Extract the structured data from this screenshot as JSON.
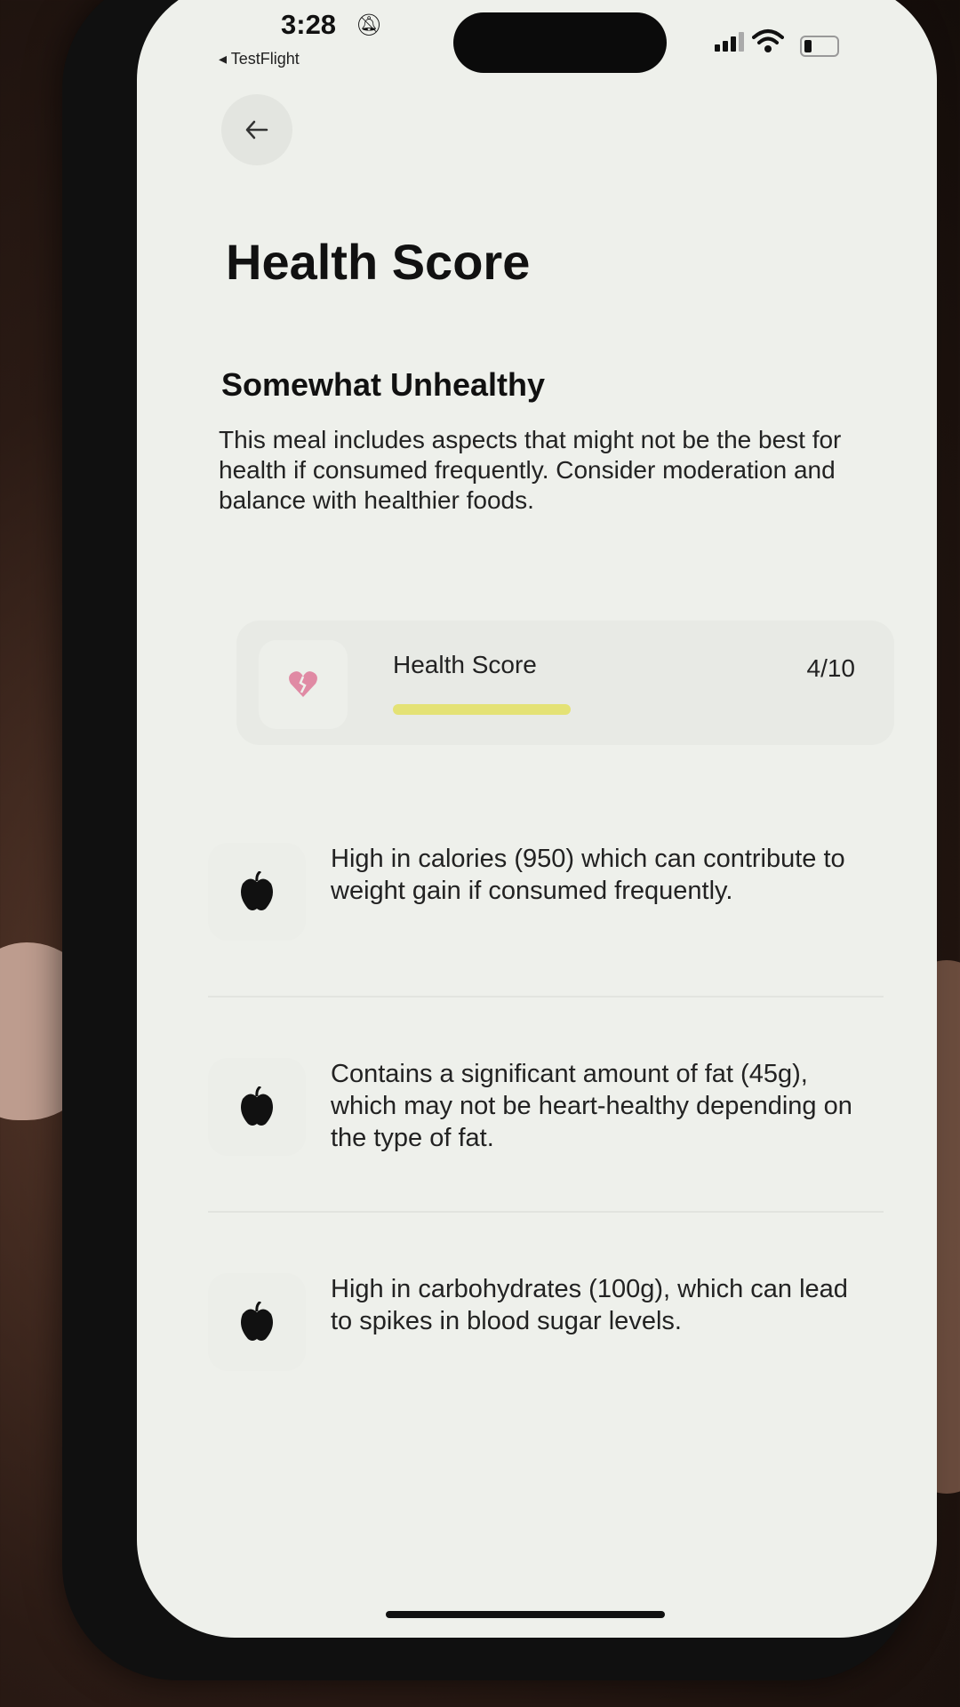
{
  "status_bar": {
    "time": "3:28",
    "back_app_label": "◂ TestFlight"
  },
  "header": {
    "title": "Health Score"
  },
  "summary": {
    "heading": "Somewhat Unhealthy",
    "description": "This meal includes aspects that might not be the best for health if consumed frequently. Consider moderation and balance with healthier foods."
  },
  "score_card": {
    "label": "Health Score",
    "value_text": "4/10",
    "score": 4,
    "max": 10,
    "bar_color": "#e4e275",
    "icon": "broken-heart-icon"
  },
  "notes": [
    {
      "icon": "apple-icon",
      "text": "High in calories (950) which can contribute to weight gain if consumed frequently."
    },
    {
      "icon": "apple-icon",
      "text": "Contains a significant amount of fat (45g), which may not be heart-healthy depending on the type of fat."
    },
    {
      "icon": "apple-icon",
      "text": "High in carbohydrates (100g), which can lead to spikes in blood sugar levels."
    }
  ]
}
